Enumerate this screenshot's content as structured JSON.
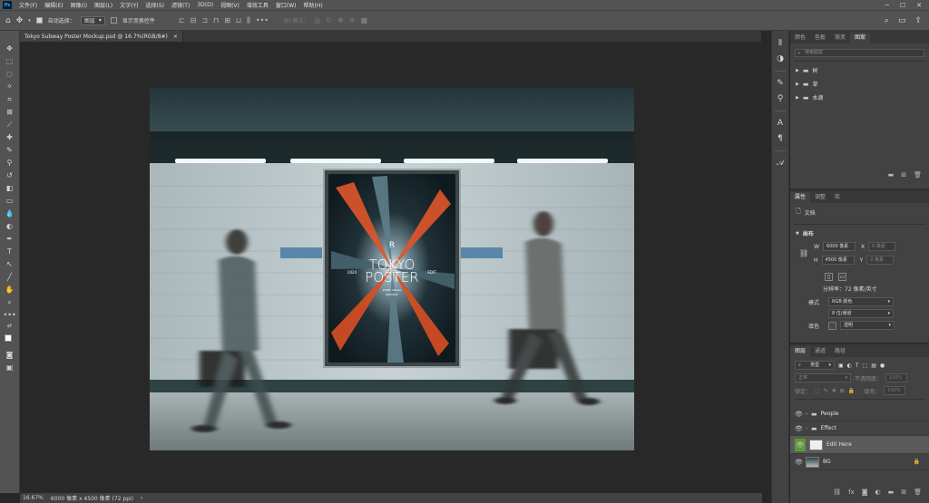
{
  "menubar": {
    "logo": "Ps",
    "items": [
      "文件(F)",
      "编辑(E)",
      "图像(I)",
      "图层(L)",
      "文字(Y)",
      "选择(S)",
      "滤镜(T)",
      "3D(D)",
      "视图(V)",
      "增效工具",
      "窗口(W)",
      "帮助(H)"
    ]
  },
  "options": {
    "auto_select_label": "自动选择：",
    "auto_select_value": "图层",
    "show_transform_label": "显示变换控件",
    "mode_3d_label": "3D 模式："
  },
  "document": {
    "tab_title": "Tokyo Subway Poster Mockup.psd @ 16.7%(RGB/8#)",
    "close_glyph": "×"
  },
  "poster": {
    "year": "2024",
    "title_line1": "TOKYO",
    "title_line2": "POSTER",
    "edit": "EDIT",
    "subtitle1": "RIVER VISUAL",
    "subtitle2": "MOCKUP"
  },
  "status": {
    "zoom": "16.67%",
    "doc_size": "6000 像素 x 4500 像素 (72 ppi)",
    "arrow": "›"
  },
  "libraries_panel": {
    "tabs": [
      "颜色",
      "色板",
      "渐变",
      "图案"
    ],
    "active_tab": 3,
    "search_placeholder": "搜索图案",
    "folders": [
      "树",
      "草",
      "水滴"
    ]
  },
  "properties_panel": {
    "tabs": [
      "属性",
      "调整",
      "库"
    ],
    "active_tab": 0,
    "doc_label": "文档",
    "canvas_section": "画布",
    "w_label": "W",
    "w_value": "6000 像素",
    "h_label": "H",
    "h_value": "4500 像素",
    "x_label": "X",
    "y_label": "Y",
    "x_value": "0 像素",
    "y_value": "0 像素",
    "resolution": "分辨率：72 像素/英寸",
    "mode_label": "模式",
    "mode_value": "RGB 颜色",
    "depth_value": "8 位/通道",
    "fill_label": "填色",
    "fill_value": "透明"
  },
  "layers_panel": {
    "tabs": [
      "图层",
      "通道",
      "路径"
    ],
    "active_tab": 0,
    "filter_label": "类型",
    "blend_mode": "正常",
    "opacity_label": "不透明度：",
    "opacity_value": "100%",
    "lock_label": "锁定：",
    "fill_label": "填充：",
    "fill_value": "100%",
    "layers": [
      {
        "name": "People",
        "type": "group"
      },
      {
        "name": "Effect",
        "type": "group"
      },
      {
        "name": "Edit Here",
        "type": "smart",
        "selected": true
      },
      {
        "name": "BG",
        "type": "image",
        "locked": true
      }
    ]
  },
  "colors": {
    "accent_orange": "#e0562a",
    "selected_layer_green": "#5a9a3a"
  }
}
